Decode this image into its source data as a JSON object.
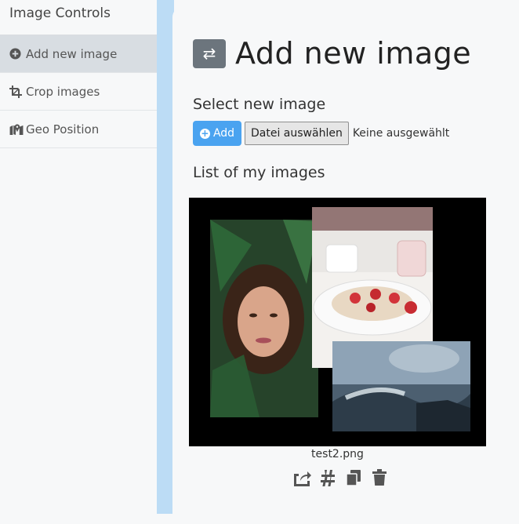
{
  "sidebar": {
    "title": "Image Controls",
    "items": [
      {
        "label": "Add new image",
        "icon": "plus-circle-icon",
        "active": true
      },
      {
        "label": "Crop images",
        "icon": "crop-icon",
        "active": false
      },
      {
        "label": "Geo Position",
        "icon": "map-marker-icon",
        "active": false
      }
    ]
  },
  "main": {
    "header_button_icon": "swap-arrows-icon",
    "title": "Add new image",
    "select_label": "Select new image",
    "add_button": "Add",
    "file_button": "Datei auswählen",
    "file_status": "Keine ausgewählt",
    "list_label": "List of my images",
    "images": [
      {
        "caption": "test2.png"
      }
    ],
    "image_actions": [
      "share-icon",
      "hashtag-icon",
      "copy-icon",
      "trash-icon"
    ]
  },
  "colors": {
    "sidebar_active": "#d8dde2",
    "divider": "#bcdcf5",
    "add_button": "#4aa3f0",
    "header_button": "#6c757d"
  }
}
